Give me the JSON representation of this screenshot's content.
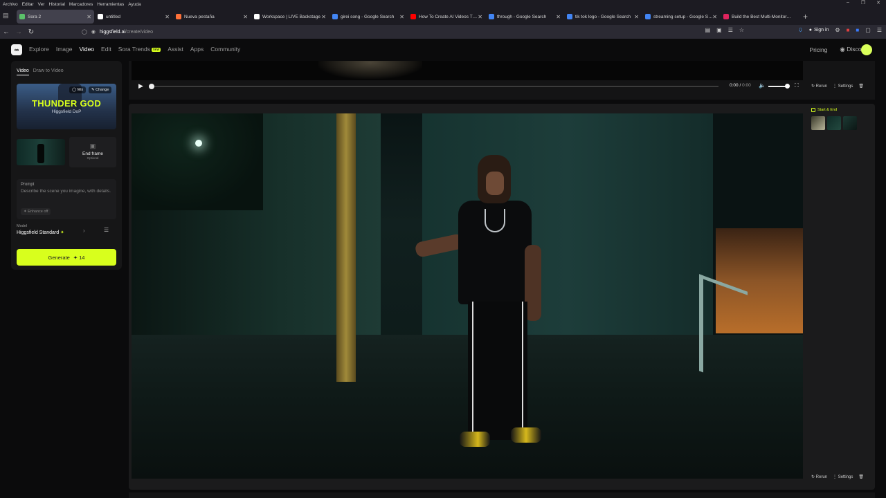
{
  "os_menu": {
    "items": [
      "Archivo",
      "Editar",
      "Ver",
      "Historial",
      "Marcadores",
      "Herramientas",
      "Ayuda"
    ]
  },
  "tabs": [
    {
      "label": "Sora 2",
      "color": "#5bc26a",
      "active": true
    },
    {
      "label": "untitled",
      "color": "#ffffff"
    },
    {
      "label": "Nueva pestaña",
      "color": "#ff7139"
    },
    {
      "label": "Workspace | LIVE Backstage",
      "color": "#ffffff"
    },
    {
      "label": "girei song - Google Search",
      "color": "#4285f4"
    },
    {
      "label": "How To Create AI Videos That A",
      "color": "#ff0000"
    },
    {
      "label": "through - Google Search",
      "color": "#4285f4"
    },
    {
      "label": "tik tok logo - Google Search",
      "color": "#4285f4"
    },
    {
      "label": "streaming setup - Google Searc",
      "color": "#4285f4"
    },
    {
      "label": "Build the Best Multi-Monitor Se",
      "color": "#e0245e"
    }
  ],
  "url": {
    "host": "higgsfield.ai",
    "path": "/create/video"
  },
  "browser": {
    "signin": "Sign in"
  },
  "nav": {
    "items": [
      "Explore",
      "Image",
      "Video",
      "Edit",
      "Sora Trends",
      "Assist",
      "Apps",
      "Community"
    ],
    "active": "Video",
    "new_badge": "new",
    "pricing": "Pricing",
    "discord": "Discord"
  },
  "panel": {
    "tab_video": "Video",
    "tab_draw": "Draw to Video",
    "hero_title": "THUNDER GOD",
    "hero_sub": "Higgsfield DoP",
    "mix": "Mix",
    "change": "Change",
    "end_frame": "End frame",
    "optional": "Optional",
    "prompt_label": "Prompt",
    "prompt_placeholder": "Describe the scene you imagine, with details.",
    "enhance": "Enhance off",
    "model_label": "Model",
    "model_value": "Higgsfield Standard",
    "generate": "Generate",
    "credits": "14"
  },
  "player": {
    "time_current": "0:00",
    "time_total": "0:00"
  },
  "card_actions": {
    "rerun": "Rerun",
    "settings": "Settings"
  },
  "sideinfo": {
    "start_end": "Start & End"
  },
  "colors": {
    "accent": "#d8ff1d",
    "background": "#0b0b0c",
    "panel": "#161617"
  }
}
